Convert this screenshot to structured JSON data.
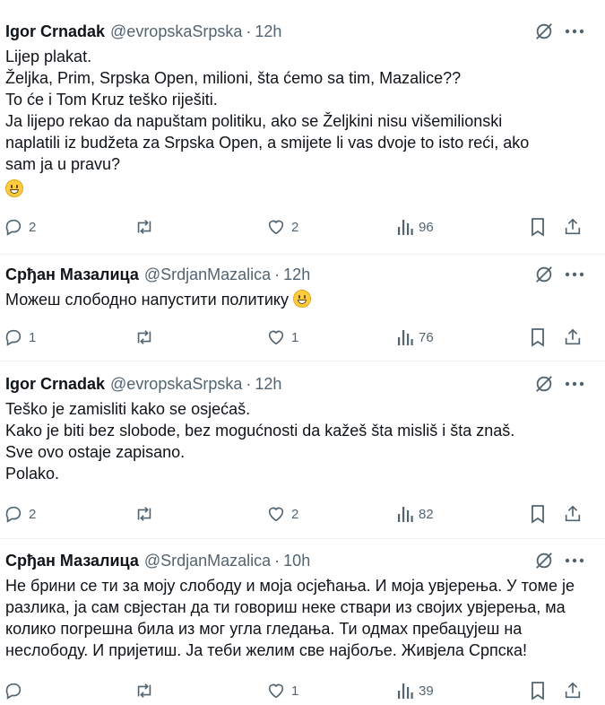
{
  "tweets": [
    {
      "name": "Igor Crnadak",
      "handle": "@evropskaSrpska",
      "dot": "·",
      "time": "12h",
      "lines": [
        "Lijep plakat.",
        "Željka, Prim, Srpska Open, milioni, šta ćemo sa tim, Mazalice??",
        "To će i Tom Kruz teško riješiti.",
        "Ja lijepo rekao da napuštam politiku, ako se Željkini nisu višemilionski",
        "naplatili iz budžeta za Srpska Open, a smijete li vas dvoje to isto reći, ako",
        "sam ja u pravu?"
      ],
      "emoji_line": "grinning-face",
      "replies": "2",
      "reposts": "",
      "likes": "2",
      "views": "96"
    },
    {
      "name": "Срђан Мазалица",
      "handle": "@SrdjanMazalica",
      "dot": "·",
      "time": "12h",
      "lines": [
        "Можеш слободно напустити политику"
      ],
      "replies": "1",
      "reposts": "",
      "likes": "1",
      "views": "76"
    },
    {
      "name": "Igor Crnadak",
      "handle": "@evropskaSrpska",
      "dot": "·",
      "time": "12h",
      "lines": [
        "Teško je zamisliti kako se osjećaš.",
        "Kako je biti bez slobode, bez mogućnosti da kažeš šta misliš i šta znaš.",
        "Sve ovo ostaje zapisano.",
        "Polako."
      ],
      "replies": "2",
      "reposts": "",
      "likes": "2",
      "views": "82"
    },
    {
      "name": "Срђан Мазалица",
      "handle": "@SrdjanMazalica",
      "dot": "·",
      "time": "10h",
      "lines": [
        "Не брини се ти за моју слободу и моја осјећања. И моја увјерења. У томе је",
        "разлика, ја сам свјестан да ти говориш неке ствари из својих увјерења, ма",
        "колико погрешна била из мог угла гледања. Ти одмах пребацујеш на",
        "неслободу. И пријетиш. Ја теби желим све најбоље. Живјела Српска!"
      ],
      "replies": "",
      "reposts": "",
      "likes": "1",
      "views": "39"
    }
  ],
  "icons": {
    "reply": "reply-icon",
    "repost": "repost-icon",
    "like": "heart-icon",
    "views": "views-icon",
    "bookmark": "bookmark-icon",
    "share": "share-icon",
    "grok": "grok-icon",
    "more": "more-icon"
  },
  "colors": {
    "text": "#0f1419",
    "muted": "#536471",
    "divider": "#eff3f4"
  }
}
